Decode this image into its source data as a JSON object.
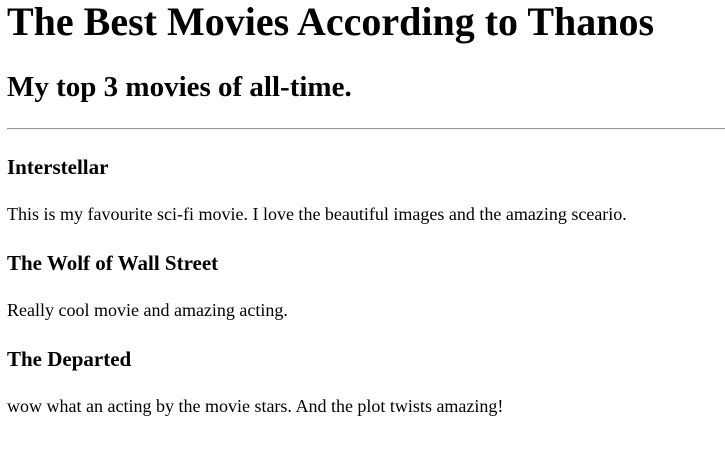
{
  "header": {
    "title": "The Best Movies According to Thanos",
    "subtitle": "My top 3 movies of all-time."
  },
  "movies": [
    {
      "title": "Interstellar",
      "description": "This is my favourite sci-fi movie. I love the beautiful images and the amazing sceario."
    },
    {
      "title": "The Wolf of Wall Street",
      "description": "Really cool movie and amazing acting."
    },
    {
      "title": "The Departed",
      "description": "wow what an acting by the movie stars. And the plot twists amazing!"
    }
  ]
}
